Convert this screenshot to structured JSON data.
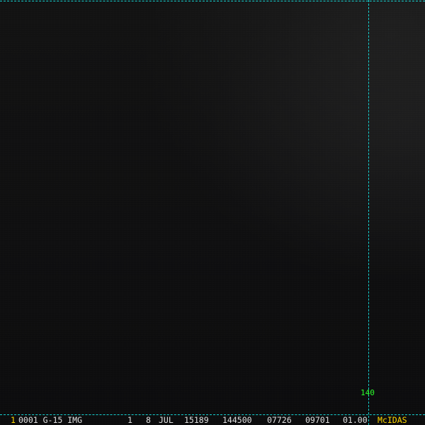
{
  "image": {
    "grid_label_lon": "140",
    "status": {
      "frame_number": "1",
      "info": "0001 G-15 IMG",
      "band": "1",
      "day": "8",
      "month": "JUL",
      "julian_date": "15189",
      "time": "144500",
      "line": "07726",
      "element": "09701",
      "magnification": "01.00",
      "software": "McIDAS"
    },
    "colors": {
      "grid": "#14d2d2",
      "grid_label": "#2cff2c",
      "status_text": "#e0e0e0",
      "status_highlight": "#ffd800"
    }
  }
}
